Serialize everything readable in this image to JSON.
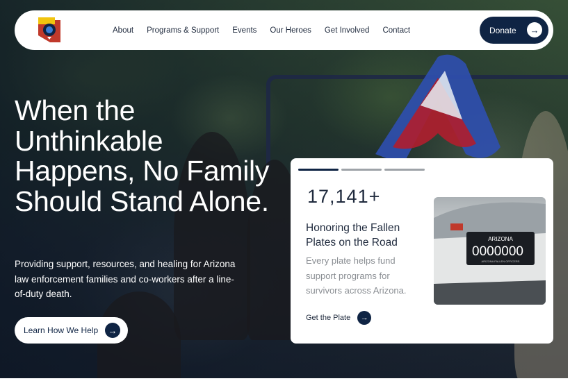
{
  "nav": {
    "links": [
      "About",
      "Programs & Support",
      "Events",
      "Our Heroes",
      "Get Involved",
      "Contact"
    ],
    "donate_label": "Donate"
  },
  "hero": {
    "headline": "When the Unthinkable Happens, No Family Should Stand Alone.",
    "subtext": "Providing support, resources, and healing for Arizona law enforcement families and co-workers after a line-of-duty death.",
    "cta_label": "Learn How We Help"
  },
  "card": {
    "stat": "17,141+",
    "title": "Honoring the Fallen Plates on the Road",
    "description": "Every plate helps fund support programs for survivors across Arizona.",
    "link_label": "Get the Plate",
    "plate_state": "ARIZONA",
    "plate_number": "0000000",
    "plate_caption": "ARIZONA FALLEN OFFICERS",
    "slides_total": 3,
    "slide_active": 1
  },
  "colors": {
    "navy": "#0f2444",
    "white": "#ffffff",
    "muted_text": "#8a8e93"
  },
  "icons": [
    "arizona-badge-logo",
    "arrow-right-icon"
  ]
}
